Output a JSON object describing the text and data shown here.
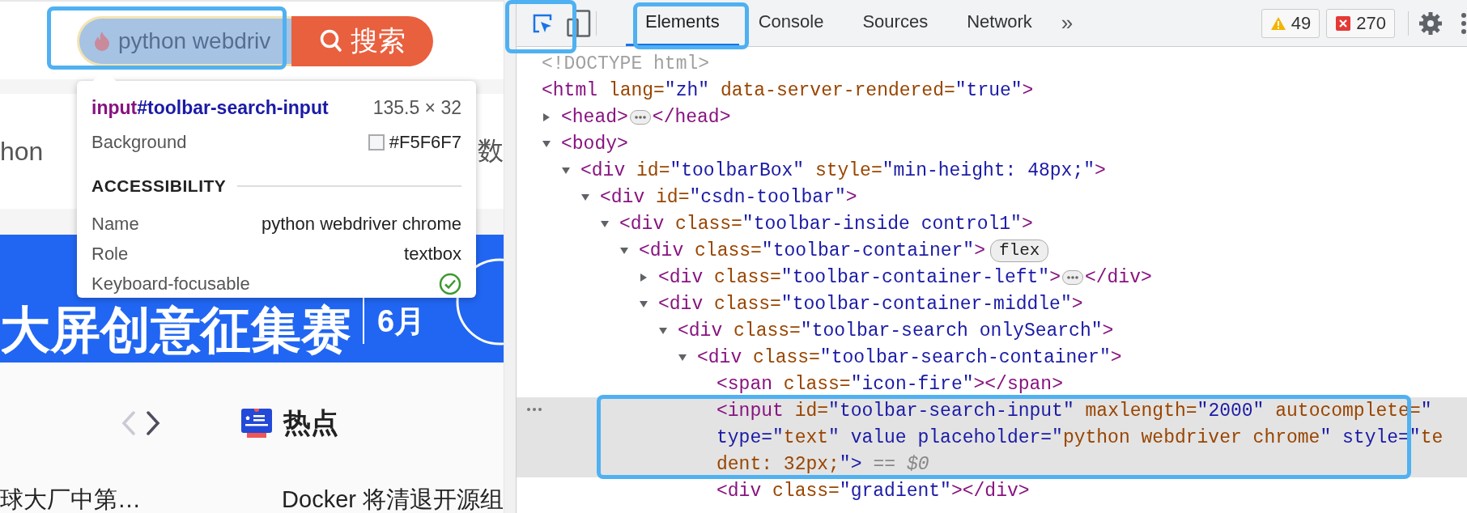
{
  "page": {
    "search": {
      "placeholder": "python webdriv",
      "button": "搜索"
    },
    "inspect_tooltip": {
      "selector_tag": "input",
      "selector_id": "#toolbar-search-input",
      "size": "135.5 × 32",
      "background_label": "Background",
      "background_value": "#F5F6F7",
      "section": "ACCESSIBILITY",
      "rows": [
        {
          "kind": "text",
          "label": "Name",
          "value": "python webdriver chrome"
        },
        {
          "kind": "text",
          "label": "Role",
          "value": "textbox"
        },
        {
          "kind": "check",
          "label": "Keyboard-focusable",
          "checked": true
        }
      ]
    },
    "article_fragments": [
      "hon",
      "数"
    ],
    "banner": {
      "title": "大屏创意征集赛",
      "date": "6月"
    },
    "nav": [
      {
        "kind": "prev",
        "disabled": true
      },
      {
        "kind": "next",
        "disabled": false
      }
    ],
    "hot_section": {
      "title": "热点"
    },
    "news": [
      "球大厂中第…",
      "Docker 将清退开源组"
    ]
  },
  "devtools": {
    "inspect_active": true,
    "tabs": [
      {
        "label": "Elements",
        "selected": true
      },
      {
        "label": "Console",
        "selected": false
      },
      {
        "label": "Sources",
        "selected": false
      },
      {
        "label": "Network",
        "selected": false
      }
    ],
    "more": "»",
    "warnings": "49",
    "errors": "270",
    "dom": [
      {
        "kind": "doctype",
        "text": "<!DOCTYPE html>",
        "selected": false
      },
      {
        "kind": "element",
        "text": "<html lang=\"zh\" data-server-rendered=\"true\">",
        "selected": false,
        "children": [
          {
            "kind": "element",
            "text": "<head>",
            "ellipsis": true,
            "close": "</head>",
            "expanded": false,
            "selected": false
          },
          {
            "kind": "element",
            "text": "<body>",
            "expanded": true,
            "selected": false,
            "children": [
              {
                "kind": "element",
                "text": "<div id=\"toolbarBox\" style=\"min-height: 48px;\">",
                "expanded": true,
                "selected": false,
                "children": [
                  {
                    "kind": "element",
                    "text": "<div id=\"csdn-toolbar\">",
                    "expanded": true,
                    "selected": false,
                    "children": [
                      {
                        "kind": "element",
                        "text": "<div class=\"toolbar-inside control1\">",
                        "expanded": true,
                        "selected": false,
                        "children": [
                          {
                            "kind": "element",
                            "text": "<div class=\"toolbar-container\">",
                            "badge": "flex",
                            "expanded": true,
                            "selected": false,
                            "children": [
                              {
                                "kind": "element",
                                "text": "<div class=\"toolbar-container-left\">",
                                "ellipsis": true,
                                "close": "</div>",
                                "expanded": false,
                                "selected": false
                              },
                              {
                                "kind": "element",
                                "text": "<div class=\"toolbar-container-middle\">",
                                "expanded": true,
                                "selected": false,
                                "children": [
                                  {
                                    "kind": "element",
                                    "text": "<div class=\"toolbar-search onlySearch\">",
                                    "expanded": true,
                                    "selected": false,
                                    "children": [
                                      {
                                        "kind": "element",
                                        "text": "<div class=\"toolbar-search-container\">",
                                        "expanded": true,
                                        "selected": false,
                                        "children": [
                                          {
                                            "kind": "element",
                                            "text": "<span class=\"icon-fire\"></span>",
                                            "selected": false
                                          },
                                          {
                                            "kind": "element",
                                            "lines": [
                                              "<input id=\"toolbar-search-input\" maxlength=\"2000\" autocomplete=\"",
                                              "type=\"text\" value placeholder=\"python webdriver chrome\" style=\"te",
                                              "dent: 32px;\">"
                                            ],
                                            "suffix": "== *$0*",
                                            "selected": true
                                          },
                                          {
                                            "kind": "element",
                                            "text": "<div class=\"gradient\"></div>",
                                            "selected": false
                                          }
                                        ]
                                      }
                                    ]
                                  }
                                ]
                              }
                            ]
                          }
                        ]
                      }
                    ]
                  }
                ]
              }
            ]
          }
        ]
      }
    ]
  }
}
